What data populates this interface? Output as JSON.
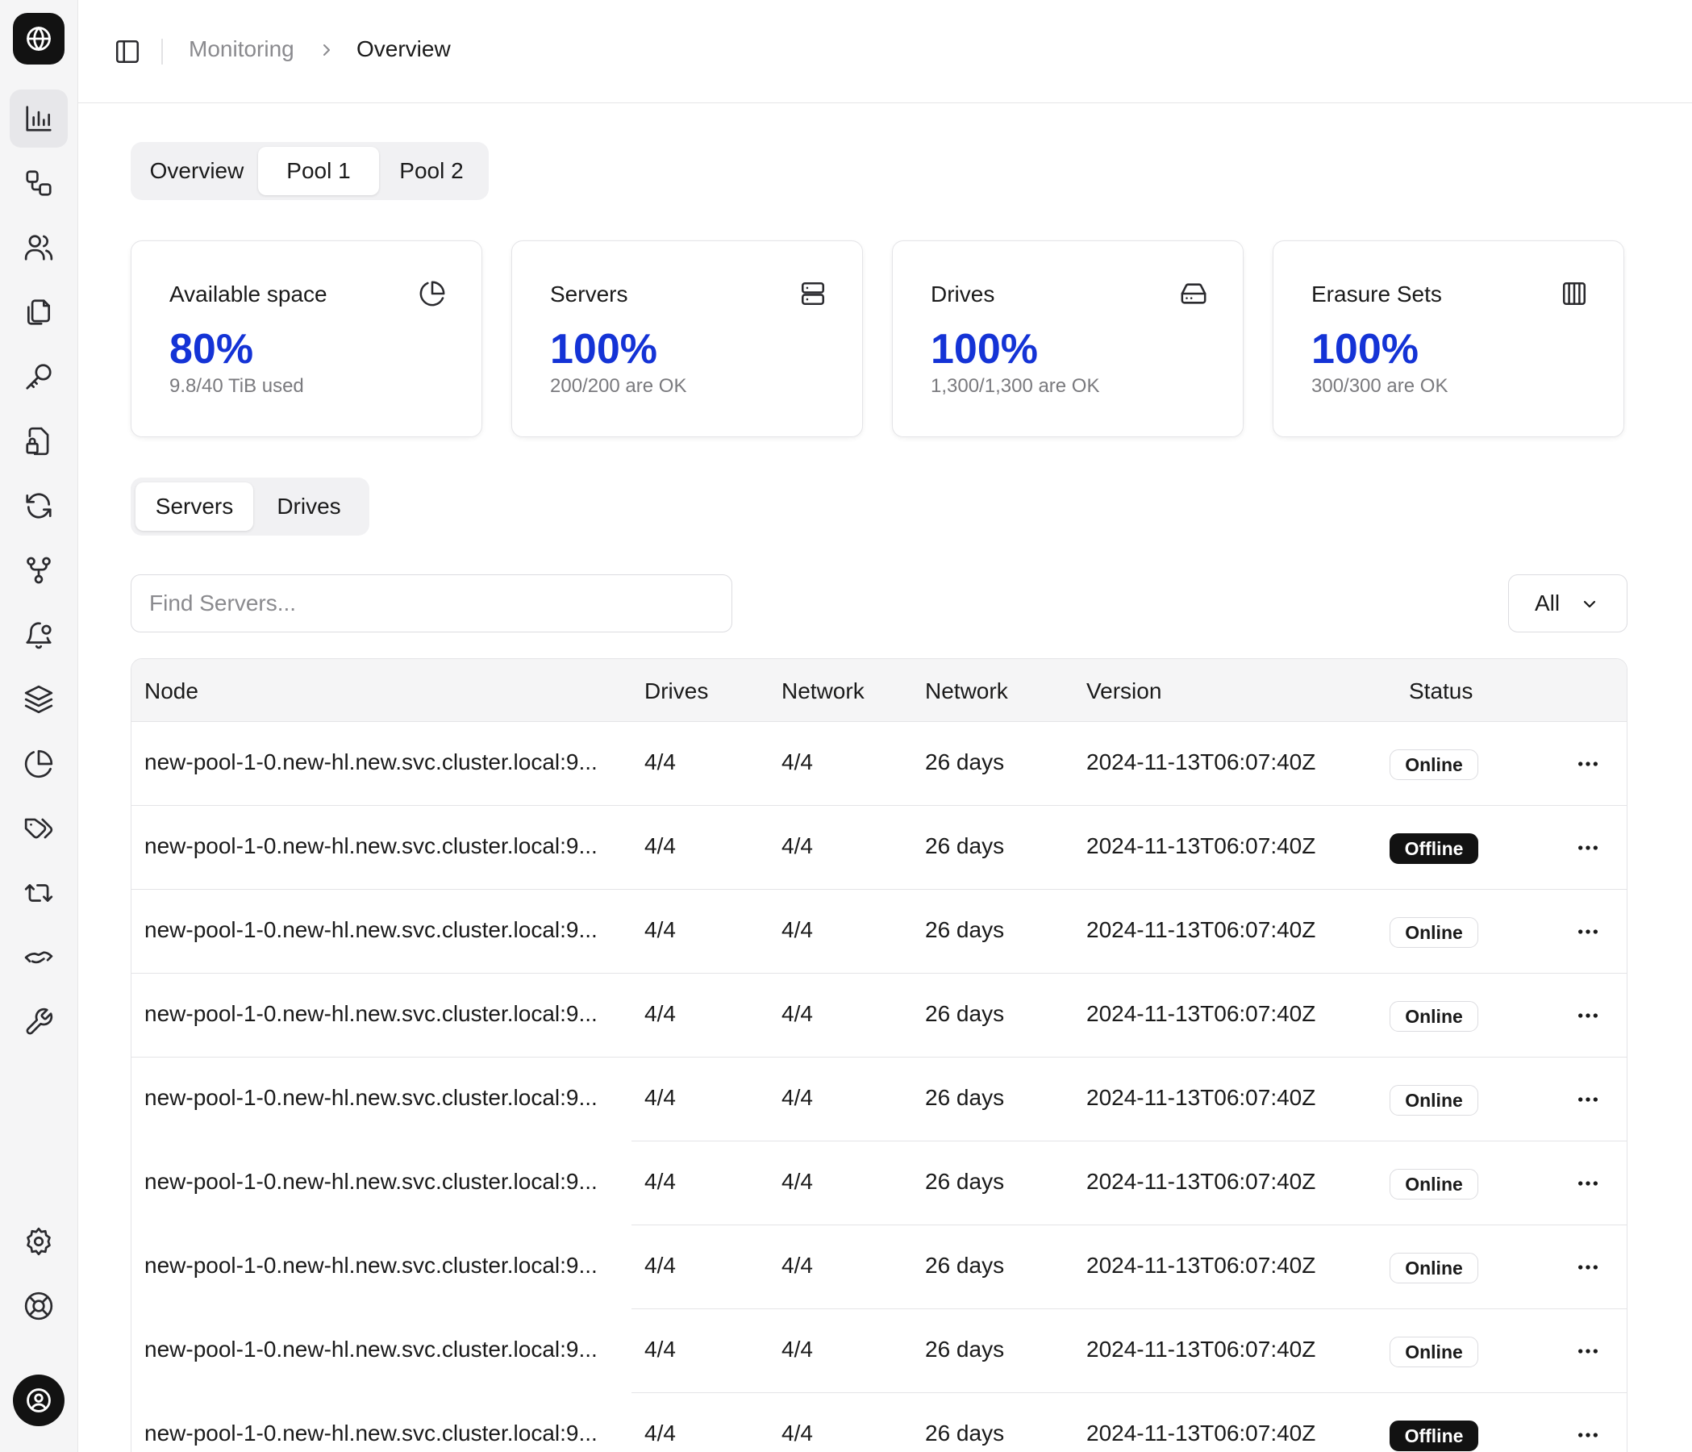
{
  "breadcrumb": {
    "parent": "Monitoring",
    "current": "Overview"
  },
  "pool_tabs": [
    {
      "label": "Overview",
      "active": false
    },
    {
      "label": "Pool 1",
      "active": true
    },
    {
      "label": "Pool 2",
      "active": false
    }
  ],
  "cards": [
    {
      "title": "Available space",
      "value": "80%",
      "sub": "9.8/40 TiB used",
      "icon": "pie-chart-icon"
    },
    {
      "title": "Servers",
      "value": "100%",
      "sub": "200/200 are OK",
      "icon": "server-icon"
    },
    {
      "title": "Drives",
      "value": "100%",
      "sub": "1,300/1,300 are OK",
      "icon": "hard-drive-icon"
    },
    {
      "title": "Erasure Sets",
      "value": "100%",
      "sub": "300/300 are OK",
      "icon": "columns-icon"
    }
  ],
  "view_tabs": [
    {
      "label": "Servers",
      "active": true
    },
    {
      "label": "Drives",
      "active": false
    }
  ],
  "search": {
    "placeholder": "Find Servers..."
  },
  "filter": {
    "value": "All"
  },
  "table": {
    "columns": [
      "Node",
      "Drives",
      "Network",
      "Network",
      "Version",
      "Status"
    ],
    "rows": [
      {
        "node": "new-pool-1-0.new-hl.new.svc.cluster.local:9...",
        "drives": "4/4",
        "network": "4/4",
        "uptime": "26 days",
        "version": "2024-11-13T06:07:40Z",
        "status": "Online"
      },
      {
        "node": "new-pool-1-0.new-hl.new.svc.cluster.local:9...",
        "drives": "4/4",
        "network": "4/4",
        "uptime": "26 days",
        "version": "2024-11-13T06:07:40Z",
        "status": "Offline"
      },
      {
        "node": "new-pool-1-0.new-hl.new.svc.cluster.local:9...",
        "drives": "4/4",
        "network": "4/4",
        "uptime": "26 days",
        "version": "2024-11-13T06:07:40Z",
        "status": "Online"
      },
      {
        "node": "new-pool-1-0.new-hl.new.svc.cluster.local:9...",
        "drives": "4/4",
        "network": "4/4",
        "uptime": "26 days",
        "version": "2024-11-13T06:07:40Z",
        "status": "Online"
      },
      {
        "node": "new-pool-1-0.new-hl.new.svc.cluster.local:9...",
        "drives": "4/4",
        "network": "4/4",
        "uptime": "26 days",
        "version": "2024-11-13T06:07:40Z",
        "status": "Online"
      },
      {
        "node": "new-pool-1-0.new-hl.new.svc.cluster.local:9...",
        "drives": "4/4",
        "network": "4/4",
        "uptime": "26 days",
        "version": "2024-11-13T06:07:40Z",
        "status": "Online"
      },
      {
        "node": "new-pool-1-0.new-hl.new.svc.cluster.local:9...",
        "drives": "4/4",
        "network": "4/4",
        "uptime": "26 days",
        "version": "2024-11-13T06:07:40Z",
        "status": "Online"
      },
      {
        "node": "new-pool-1-0.new-hl.new.svc.cluster.local:9...",
        "drives": "4/4",
        "network": "4/4",
        "uptime": "26 days",
        "version": "2024-11-13T06:07:40Z",
        "status": "Online"
      },
      {
        "node": "new-pool-1-0.new-hl.new.svc.cluster.local:9...",
        "drives": "4/4",
        "network": "4/4",
        "uptime": "26 days",
        "version": "2024-11-13T06:07:40Z",
        "status": "Offline"
      }
    ]
  },
  "sidebar": {
    "logo_icon": "globe-icon",
    "items": [
      {
        "icon": "bar-chart-icon",
        "active": true
      },
      {
        "icon": "shapes-icon",
        "active": false
      },
      {
        "icon": "users-icon",
        "active": false
      },
      {
        "icon": "copy-icon",
        "active": false
      },
      {
        "icon": "key-icon",
        "active": false
      },
      {
        "icon": "file-lock-icon",
        "active": false
      },
      {
        "icon": "refresh-icon",
        "active": false
      },
      {
        "icon": "git-fork-icon",
        "active": false
      },
      {
        "icon": "bell-icon",
        "active": false
      },
      {
        "icon": "layers-icon",
        "active": false
      },
      {
        "icon": "pie-chart-icon",
        "active": false
      },
      {
        "icon": "tags-icon",
        "active": false
      },
      {
        "icon": "repeat-icon",
        "active": false
      },
      {
        "icon": "handshake-icon",
        "active": false
      },
      {
        "icon": "wrench-icon",
        "active": false
      }
    ],
    "bottom_items": [
      {
        "icon": "settings-icon"
      },
      {
        "icon": "life-buoy-icon"
      }
    ],
    "avatar_icon": "user-circle-icon"
  },
  "colors": {
    "accent": "#1433d6",
    "sidebar_bg": "#f5f5f6",
    "dark": "#121212"
  }
}
